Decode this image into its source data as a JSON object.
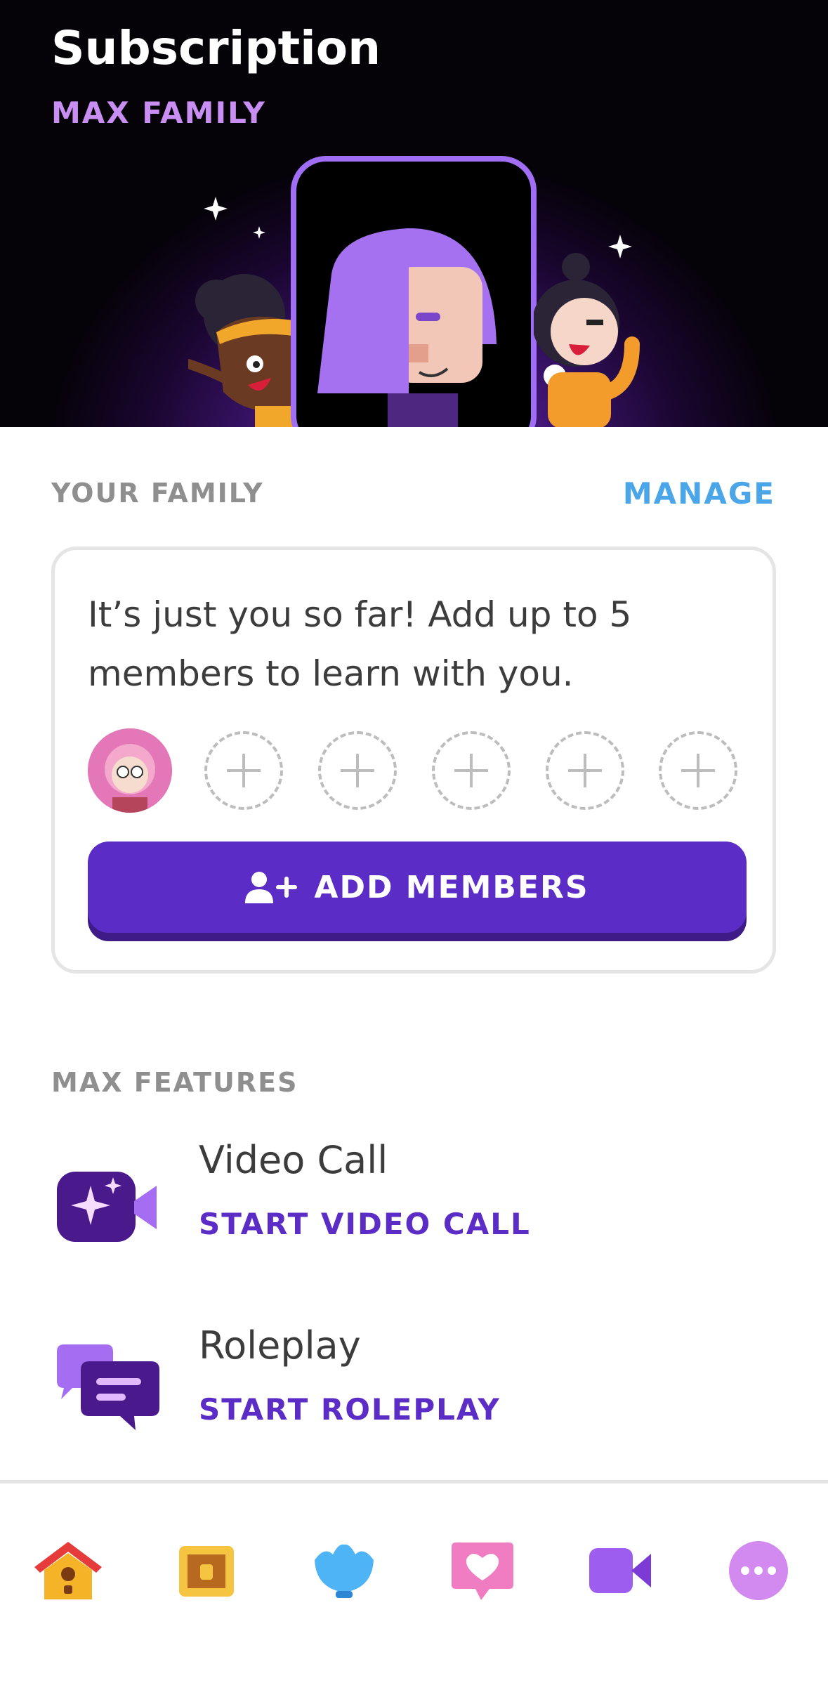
{
  "header": {
    "title": "Subscription",
    "plan": "MAX FAMILY"
  },
  "family": {
    "section_label": "YOUR FAMILY",
    "manage_label": "MANAGE",
    "message": "It’s just you so far! Add up to 5 members to learn with you.",
    "empty_slots": 5,
    "add_button_label": "ADD MEMBERS"
  },
  "features": {
    "section_label": "MAX FEATURES",
    "items": [
      {
        "title": "Video Call",
        "action": "START VIDEO CALL",
        "icon": "video-sparkle-icon"
      },
      {
        "title": "Roleplay",
        "action": "START ROLEPLAY",
        "icon": "chat-bubbles-icon"
      }
    ]
  },
  "tabbar": {
    "items": [
      "home-icon",
      "chest-icon",
      "shell-icon",
      "heart-chat-icon",
      "video-camera-icon",
      "more-icon"
    ]
  },
  "colors": {
    "accent": "#5b2cc6",
    "link_blue": "#4aa6e8",
    "plan_purple": "#c88ef2"
  }
}
